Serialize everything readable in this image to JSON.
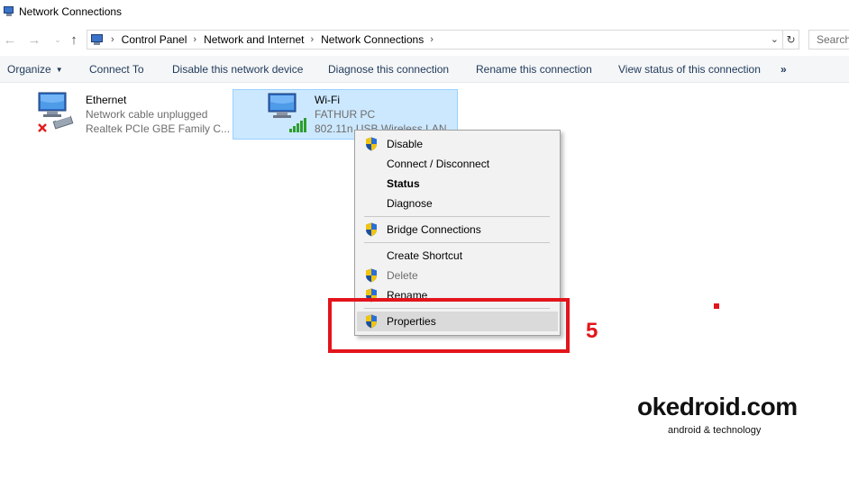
{
  "window": {
    "title": "Network Connections",
    "icon": "network-connections-icon"
  },
  "address_bar": {
    "breadcrumbs": [
      "Control Panel",
      "Network and Internet",
      "Network Connections"
    ],
    "search_placeholder": "Search"
  },
  "command_bar": {
    "organize": "Organize",
    "connect_to": "Connect To",
    "disable_device": "Disable this network device",
    "diagnose": "Diagnose this connection",
    "rename": "Rename this connection",
    "view_status": "View status of this connection",
    "more": "»"
  },
  "connections": [
    {
      "name": "Ethernet",
      "status": "Network cable unplugged",
      "device": "Realtek PCIe GBE Family C...",
      "selected": false
    },
    {
      "name": "Wi-Fi",
      "status": "FATHUR PC",
      "device": "802.11n USB Wireless LAN",
      "selected": true
    }
  ],
  "context_menu": {
    "items": [
      {
        "label": "Disable",
        "shield": true,
        "bold": false,
        "disabled": false
      },
      {
        "label": "Connect / Disconnect",
        "shield": false,
        "bold": false,
        "disabled": false
      },
      {
        "label": "Status",
        "shield": false,
        "bold": true,
        "disabled": false
      },
      {
        "label": "Diagnose",
        "shield": false,
        "bold": false,
        "disabled": false
      },
      {
        "label": "Bridge Connections",
        "shield": true,
        "bold": false,
        "disabled": false
      },
      {
        "label": "Create Shortcut",
        "shield": false,
        "bold": false,
        "disabled": false
      },
      {
        "label": "Delete",
        "shield": true,
        "bold": false,
        "disabled": true
      },
      {
        "label": "Rename",
        "shield": true,
        "bold": false,
        "disabled": false
      },
      {
        "label": "Properties",
        "shield": true,
        "bold": false,
        "disabled": false,
        "highlighted": true
      }
    ]
  },
  "annotation": {
    "step": "5",
    "color": "#e3141b"
  },
  "watermark": {
    "brand": "okedroid.com",
    "tagline": "android & technology"
  },
  "colors": {
    "selection_bg": "#cce8ff",
    "selection_border": "#99d1ff",
    "command_text": "#1e395b",
    "menu_bg": "#f2f2f2"
  }
}
